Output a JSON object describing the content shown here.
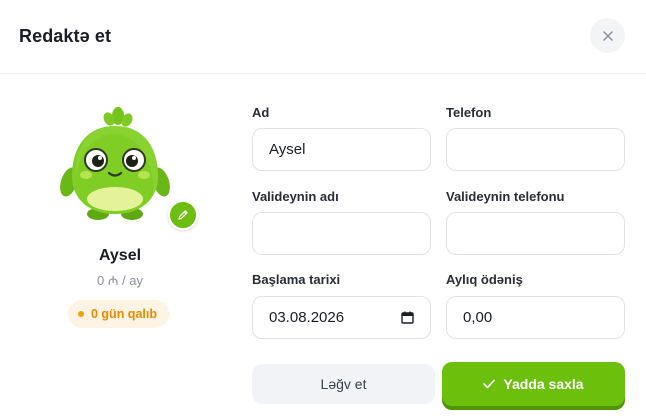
{
  "dialog": {
    "title": "Redaktə et",
    "close_icon": "close-icon"
  },
  "child": {
    "name": "Aysel",
    "fee": "0 ₼ / ay",
    "days_left": "0 gün qalıb",
    "avatar_icon": "green-monster-avatar",
    "edit_icon": "pencil-icon",
    "accent_color": "#6cc00c",
    "badge_color": "#f59e0b"
  },
  "form": {
    "name_label": "Ad",
    "name_value": "Aysel",
    "phone_label": "Telefon",
    "phone_value": "",
    "parent_name_label": "Valideynin adı",
    "parent_name_value": "",
    "parent_phone_label": "Valideynin telefonu",
    "parent_phone_value": "",
    "start_date_label": "Başlama tarixi",
    "start_date_value": "03.08.2026",
    "monthly_fee_label": "Aylıq ödəniş",
    "monthly_fee_value": "0,00",
    "calendar_icon": "calendar-icon"
  },
  "actions": {
    "cancel_label": "Ləğv et",
    "save_label": "Yadda saxla",
    "save_icon": "check-icon"
  }
}
